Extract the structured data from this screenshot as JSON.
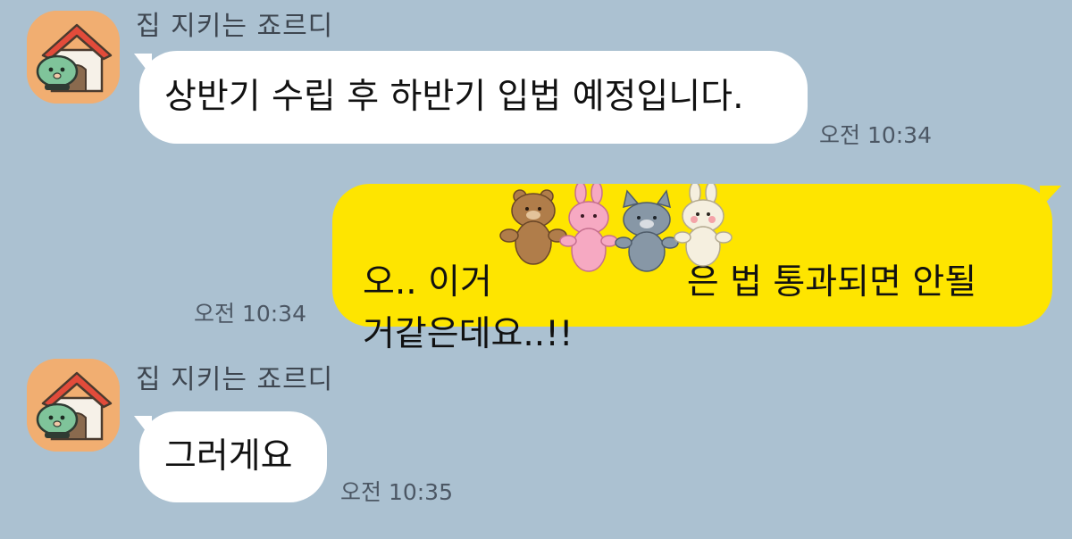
{
  "chat": {
    "messages": [
      {
        "direction": "incoming",
        "sender": "집 지키는 죠르디",
        "avatar_icon": "jordy-house-icon",
        "text": "상반기 수립 후 하반기 입법 예정입니다.",
        "time": "오전 10:34"
      },
      {
        "direction": "outgoing",
        "text_line1_start": "오.. 이거",
        "text_line1_end": "은 법 통과되면 안될",
        "text_line2": "거같은데요..!!",
        "sticker_overlay_icon": "bear-bunny-cat-rabbit-sticker-icon",
        "time": "오전 10:34"
      },
      {
        "direction": "incoming",
        "sender": "집 지키는 죠르디",
        "avatar_icon": "jordy-house-icon",
        "text": "그러게요",
        "time": "오전 10:35"
      }
    ]
  },
  "colors": {
    "background": "#abc1d1",
    "incoming_bubble": "#ffffff",
    "outgoing_bubble": "#fee500",
    "avatar_bg": "#f1ae71",
    "timestamp": "#4c5764"
  }
}
